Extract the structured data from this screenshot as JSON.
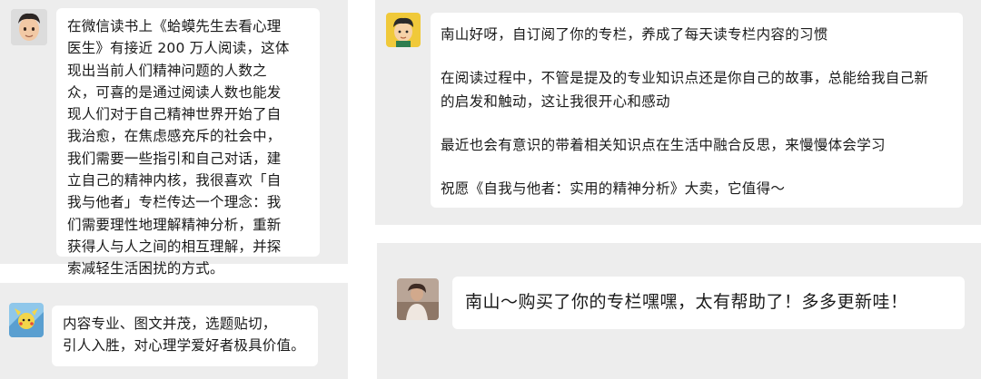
{
  "messages": [
    {
      "avatar": "memoji-avatar-icon",
      "paragraphs": [
        "在微信读书上《蛤蟆先生去看心理\n医生》有接近 200 万人阅读，这体\n现出当前人们精神问题的人数之\n众，可喜的是通过阅读人数也能发\n现人们对于自己精神世界开始了自\n我治愈，在焦虑感充斥的社会中，\n我们需要一些指引和自己对话，建\n立自己的精神内核，我很喜欢「自\n我与他者」专栏传达一个理念：我\n们需要理性地理解精神分析，重新\n获得人与人之间的相互理解，并探\n索减轻生活困扰的方式。"
      ]
    },
    {
      "avatar": "cartoon-avatar-icon",
      "paragraphs": [
        "内容专业、图文并茂，选题贴切，\n引人入胜，对心理学爱好者极具价值。"
      ]
    },
    {
      "avatar": "cartoon-boy-avatar-icon",
      "paragraphs": [
        "南山好呀，自订阅了你的专栏，养成了每天读专栏内容的习惯",
        "在阅读过程中，不管是提及的专业知识点还是你自己的故事，总能给我自己新\n的启发和触动，这让我很开心和感动",
        "最近也会有意识的带着相关知识点在生活中融合反思，来慢慢体会学习",
        "祝愿《自我与他者：实用的精神分析》大卖，它值得～"
      ]
    },
    {
      "avatar": "photo-avatar-icon",
      "paragraphs": [
        "南山～购买了你的专栏嘿嘿，太有帮助了！多多更新哇！"
      ]
    }
  ]
}
